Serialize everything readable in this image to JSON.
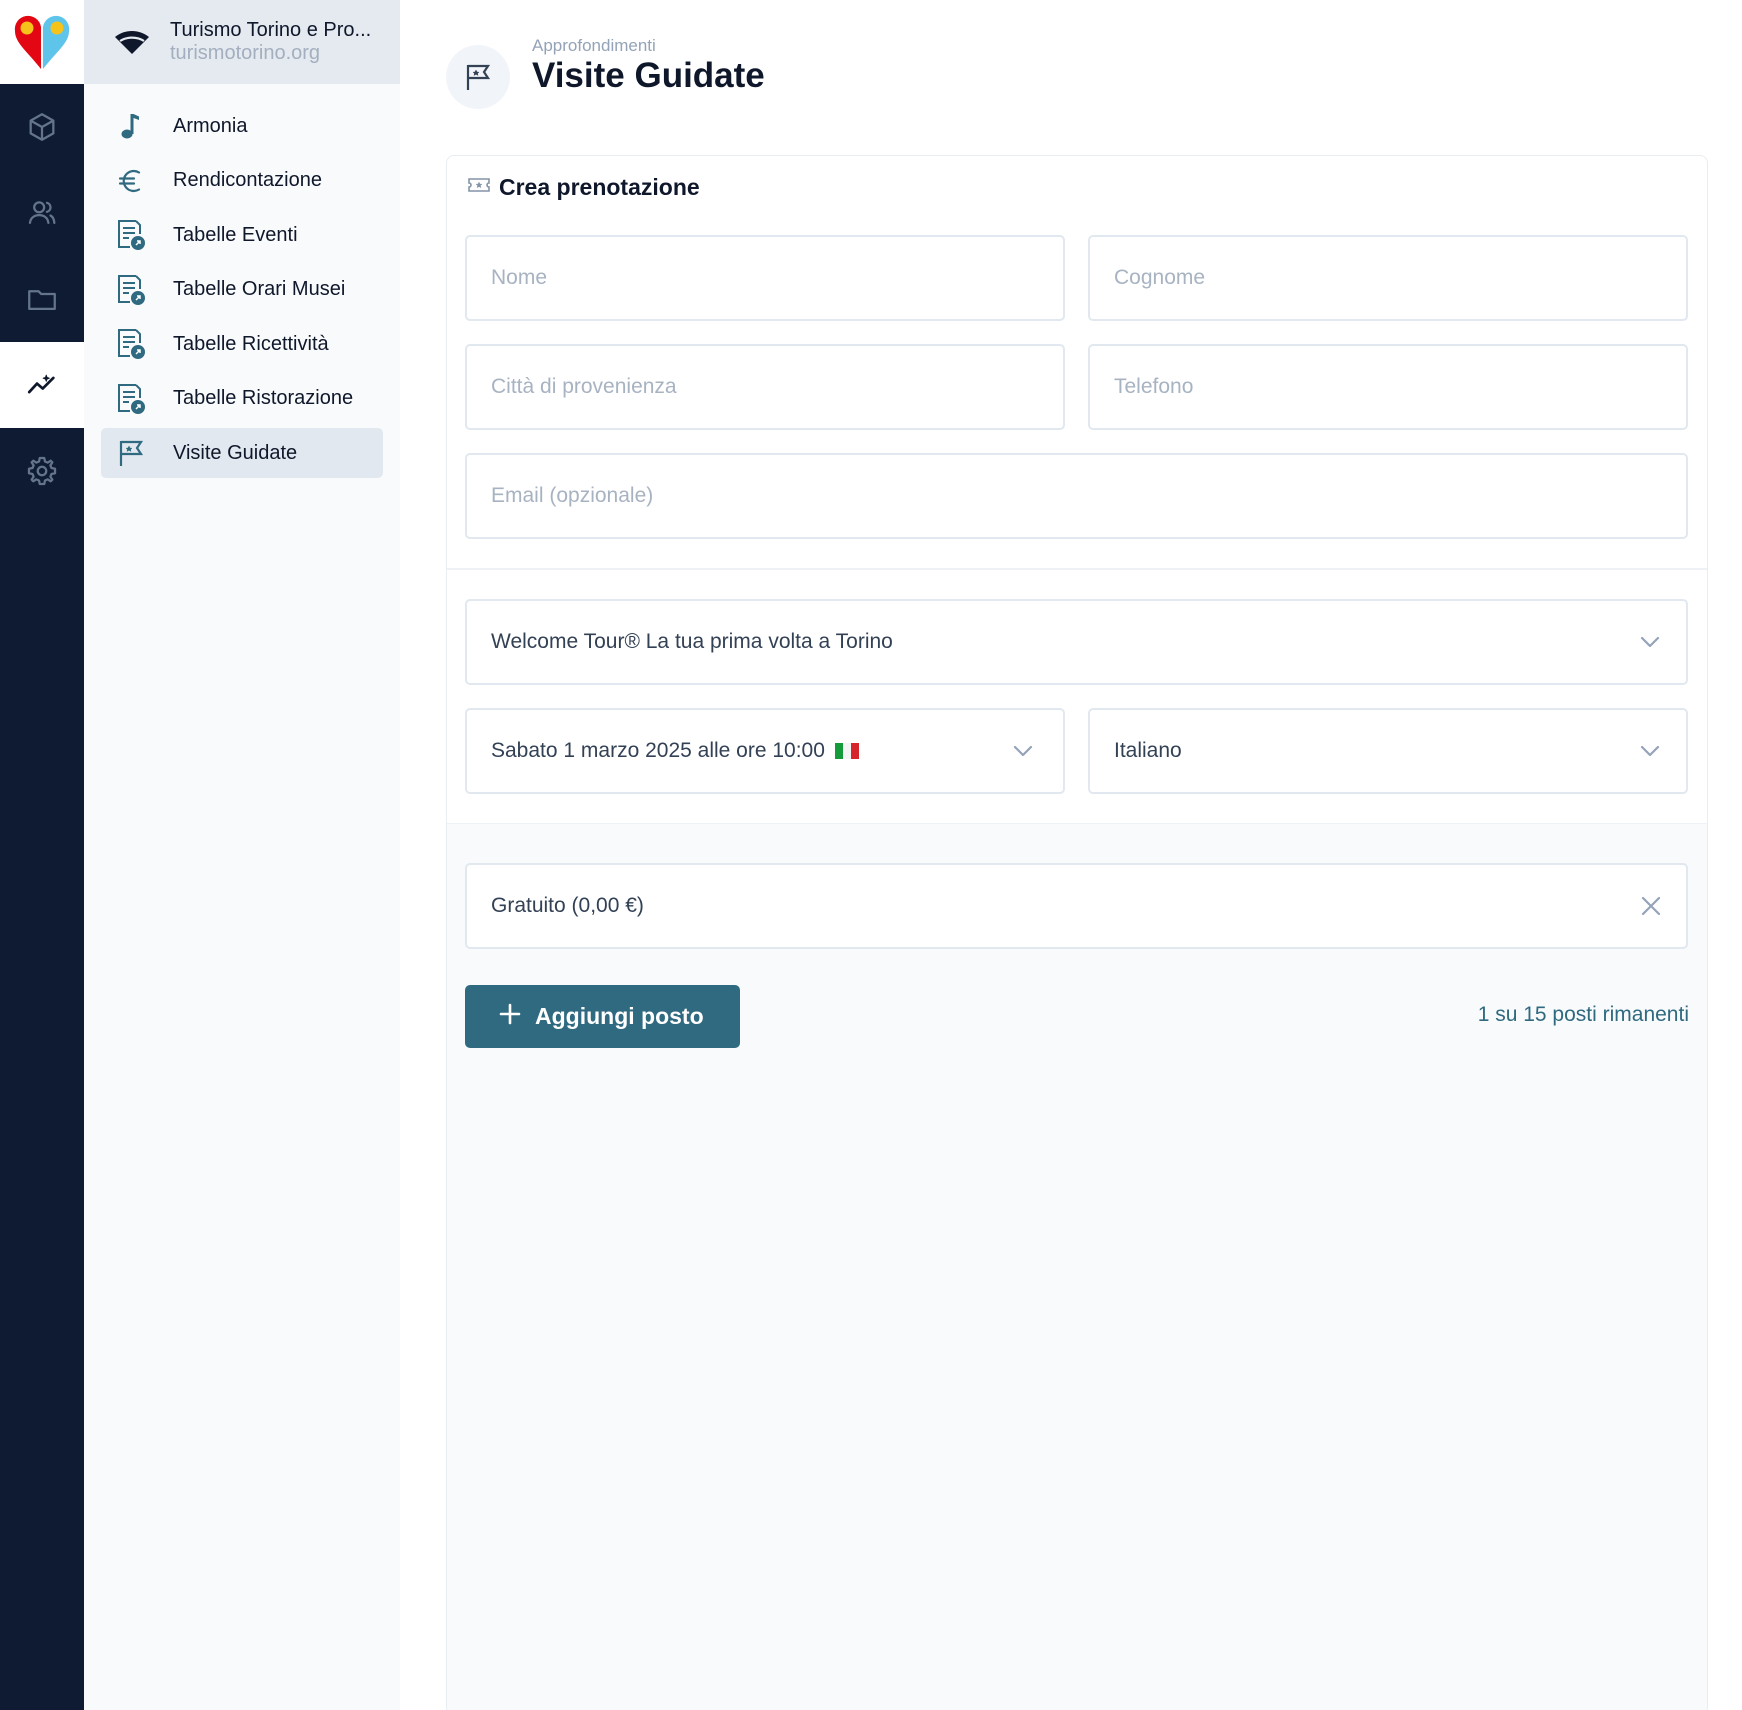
{
  "org": {
    "name": "Turismo Torino e Pro...",
    "domain": "turismotorino.org"
  },
  "rail": {
    "items": [
      {
        "icon": "cube-icon"
      },
      {
        "icon": "users-icon"
      },
      {
        "icon": "folder-icon"
      },
      {
        "icon": "analytics-icon",
        "active": true
      },
      {
        "icon": "gear-icon"
      }
    ]
  },
  "sidebar": {
    "items": [
      {
        "label": "Armonia",
        "icon": "music-note-icon"
      },
      {
        "label": "Rendicontazione",
        "icon": "euro-icon"
      },
      {
        "label": "Tabelle Eventi",
        "icon": "table-doc-icon"
      },
      {
        "label": "Tabelle Orari Musei",
        "icon": "table-doc-icon"
      },
      {
        "label": "Tabelle Ricettività",
        "icon": "table-doc-icon"
      },
      {
        "label": "Tabelle Ristorazione",
        "icon": "table-doc-icon"
      },
      {
        "label": "Visite Guidate",
        "icon": "flag-icon",
        "active": true
      }
    ]
  },
  "page": {
    "breadcrumb": "Approfondimenti",
    "title": "Visite Guidate"
  },
  "form": {
    "heading": "Crea prenotazione",
    "nome_placeholder": "Nome",
    "cognome_placeholder": "Cognome",
    "citta_placeholder": "Città di provenienza",
    "telefono_placeholder": "Telefono",
    "email_placeholder": "Email (opzionale)",
    "tour": "Welcome Tour® La tua prima volta a Torino",
    "datetime": "Sabato 1 marzo 2025 alle ore 10:00",
    "language": "Italiano",
    "ticket": "Gratuito (0,00 €)",
    "add_label": "Aggiungi posto",
    "remaining": "1 su 15 posti rimanenti"
  },
  "colors": {
    "rail_bg": "#0f1b33",
    "accent": "#2f6a80",
    "sidebar_bg": "#f8fafc"
  }
}
